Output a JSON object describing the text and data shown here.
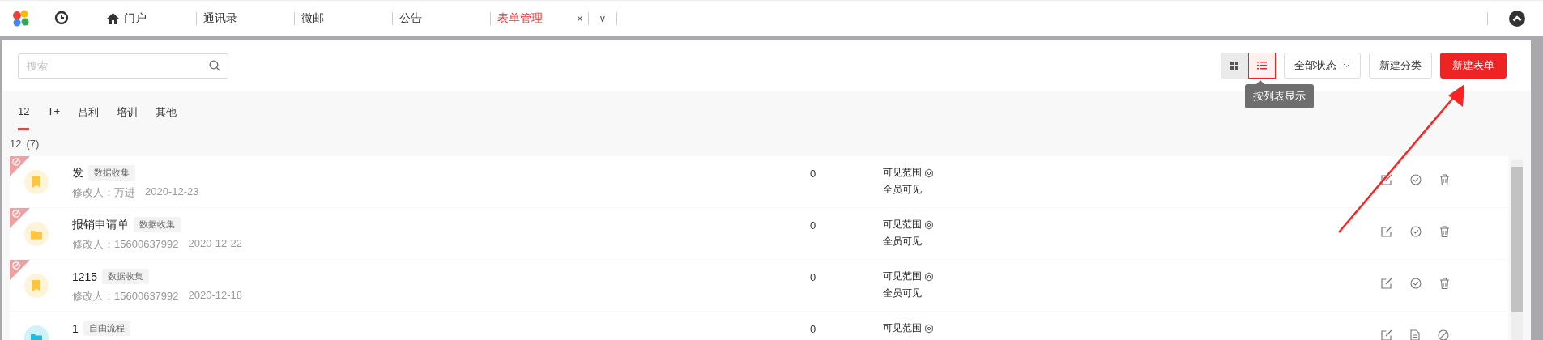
{
  "nav_tabs": [
    {
      "label": "门户",
      "kind": "home",
      "selected": false
    },
    {
      "label": "通讯录",
      "kind": "plain",
      "selected": false
    },
    {
      "label": "微邮",
      "kind": "plain",
      "selected": false
    },
    {
      "label": "公告",
      "kind": "plain",
      "selected": false
    },
    {
      "label": "表单管理",
      "kind": "plain",
      "selected": true
    }
  ],
  "nav_close": "×",
  "nav_more": "∨",
  "search": {
    "placeholder": "搜索"
  },
  "view_toggle": [
    {
      "kind": "grid",
      "selected": false
    },
    {
      "kind": "list",
      "selected": true
    }
  ],
  "tooltip": "按列表显示",
  "status_filter": "全部状态",
  "buttons": [
    {
      "label": "新建分类",
      "kind": "default"
    },
    {
      "label": "新建表单",
      "kind": "primary"
    }
  ],
  "category_tabs": [
    {
      "label": "12",
      "selected": true
    },
    {
      "label": "T+",
      "selected": false
    },
    {
      "label": "吕利",
      "selected": false
    },
    {
      "label": "培训",
      "selected": false
    },
    {
      "label": "其他",
      "selected": false
    }
  ],
  "group": {
    "name": "12",
    "count": "(7)"
  },
  "rows": [
    {
      "title": "发",
      "tag": "数据收集",
      "modifier": "修改人：万进",
      "date": "2020-12-23",
      "disabled": true,
      "icon": {
        "kind": "bookmark",
        "color": "#ffc53d"
      },
      "count": "0",
      "visibility": "可见范围",
      "visibility_detail": "全员可见",
      "actions": [
        {
          "kind": "edit"
        },
        {
          "kind": "check"
        },
        {
          "kind": "delete"
        }
      ]
    },
    {
      "title": "报销申请单",
      "tag": "数据收集",
      "modifier": "修改人：15600637992",
      "date": "2020-12-22",
      "disabled": true,
      "icon": {
        "kind": "folder",
        "color": "#ffc53d"
      },
      "count": "0",
      "visibility": "可见范围",
      "visibility_detail": "全员可见",
      "actions": [
        {
          "kind": "edit"
        },
        {
          "kind": "check"
        },
        {
          "kind": "delete"
        }
      ]
    },
    {
      "title": "1215",
      "tag": "数据收集",
      "modifier": "修改人：15600637992",
      "date": "2020-12-18",
      "disabled": true,
      "icon": {
        "kind": "bookmark",
        "color": "#ffc53d"
      },
      "count": "0",
      "visibility": "可见范围",
      "visibility_detail": "全员可见",
      "actions": [
        {
          "kind": "edit"
        },
        {
          "kind": "check"
        },
        {
          "kind": "delete"
        }
      ]
    },
    {
      "title": "1",
      "tag": "自由流程",
      "disabled": false,
      "icon": {
        "kind": "folder",
        "color": "#13c2e6"
      },
      "count": "0",
      "visibility": "可见范围",
      "actions": [
        {
          "kind": "edit"
        },
        {
          "kind": "document"
        },
        {
          "kind": "ban"
        }
      ]
    }
  ]
}
